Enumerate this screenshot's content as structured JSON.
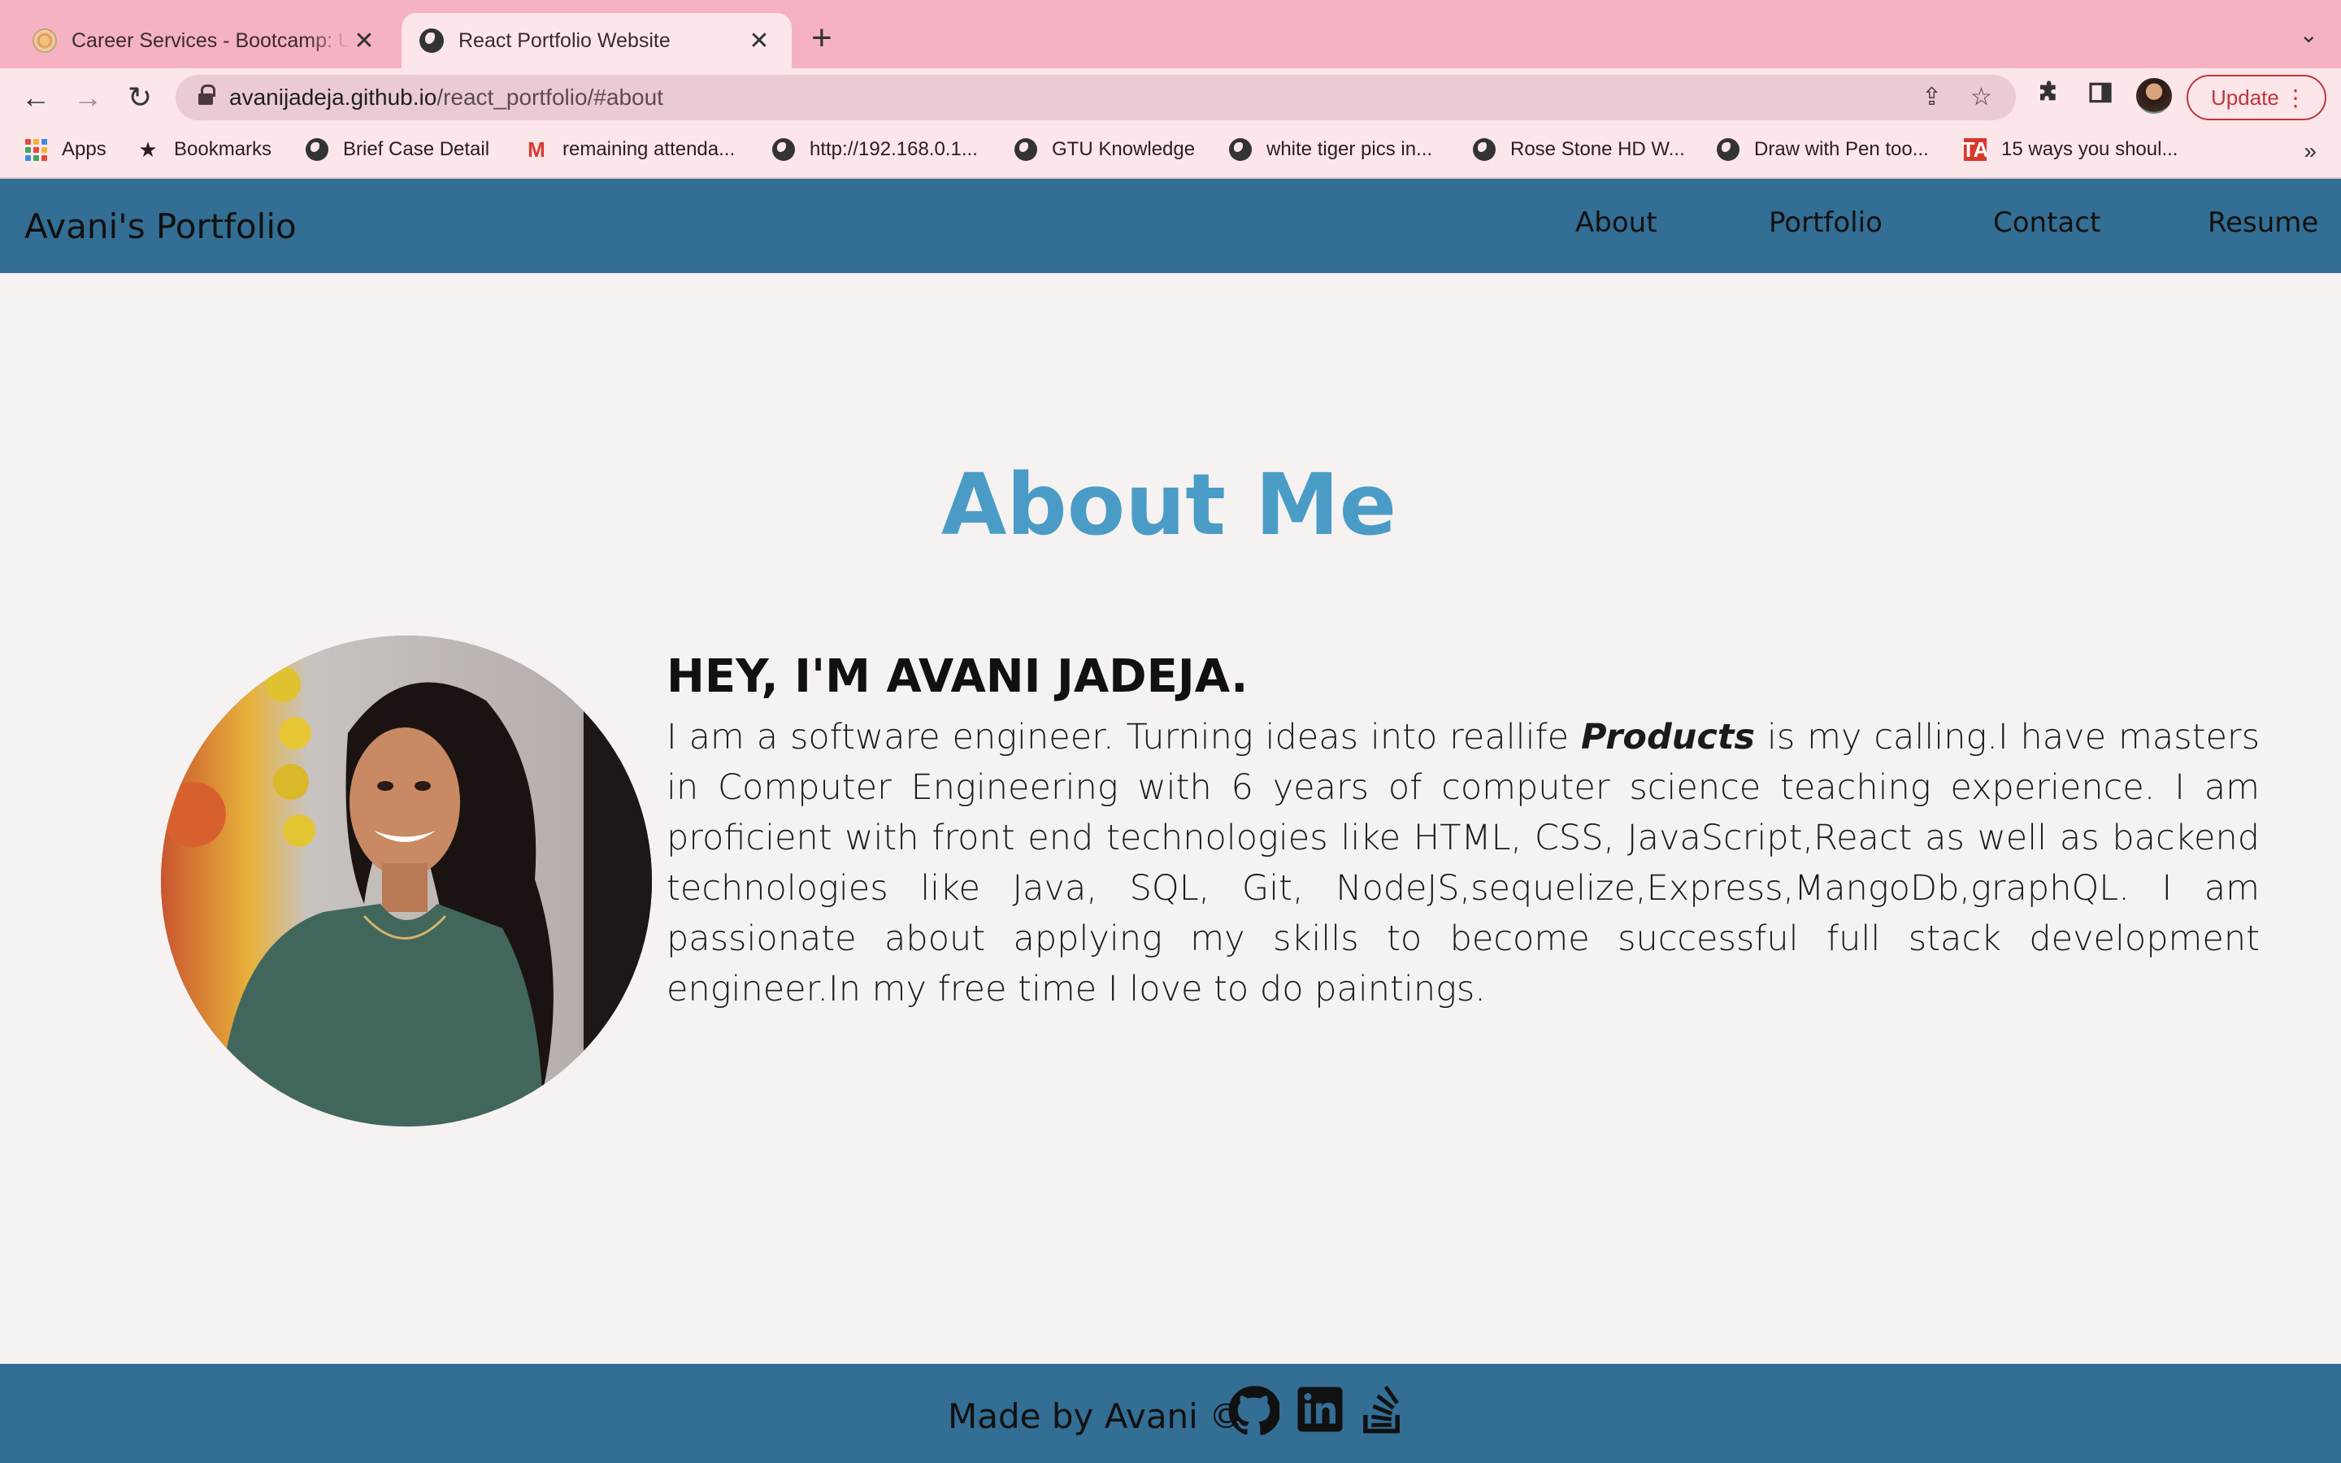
{
  "browser": {
    "tabs": [
      {
        "title": "Career Services - Bootcamp: U",
        "close": "✕"
      },
      {
        "title": "React Portfolio Website",
        "close": "✕"
      }
    ],
    "new_tab": "+",
    "tab_menu": "⌄",
    "url_host": "avanijadeja.github.io",
    "url_path": "/react_portfolio/#about",
    "update_label": "Update",
    "bookmarks": [
      {
        "label": "Apps",
        "icon": "apps-grid-icon"
      },
      {
        "label": "Bookmarks",
        "icon": "star-icon"
      },
      {
        "label": "Brief Case Detail",
        "icon": "globe-icon"
      },
      {
        "label": "remaining attenda...",
        "icon": "gmail-icon"
      },
      {
        "label": "http://192.168.0.1...",
        "icon": "globe-icon"
      },
      {
        "label": "GTU Knowledge",
        "icon": "globe-icon"
      },
      {
        "label": "white tiger pics in...",
        "icon": "globe-icon"
      },
      {
        "label": "Rose Stone HD W...",
        "icon": "globe-icon"
      },
      {
        "label": "Draw with Pen too...",
        "icon": "globe-icon"
      },
      {
        "label": "15 ways you shoul...",
        "icon": "ta-icon"
      }
    ],
    "bookmarks_more": "»"
  },
  "site": {
    "brand": "Avani's Portfolio",
    "nav": [
      "About",
      "Portfolio",
      "Contact",
      "Resume"
    ],
    "accent_color": "#4a9cc7",
    "bar_color": "#336e94"
  },
  "about": {
    "title": "About Me",
    "heading": "HEY, I'M AVANI JADEJA.",
    "text_before": "I am a software engineer. Turning ideas into reallife ",
    "text_em": "Products",
    "text_after": " is my calling.I have masters in Computer Engineering with 6 years of computer science teaching experience. I am proficient with front end technologies like HTML, CSS, JavaScript,React as well as backend technologies like Java, SQL, Git, NodeJS,sequelize,Express,MangoDb,graphQL. I am passionate about applying my skills to become successful full stack development engineer.In my free time I love to do paintings."
  },
  "footer": {
    "text": "Made by Avani ©",
    "icons": [
      "github-icon",
      "linkedin-icon",
      "stackoverflow-icon"
    ]
  }
}
